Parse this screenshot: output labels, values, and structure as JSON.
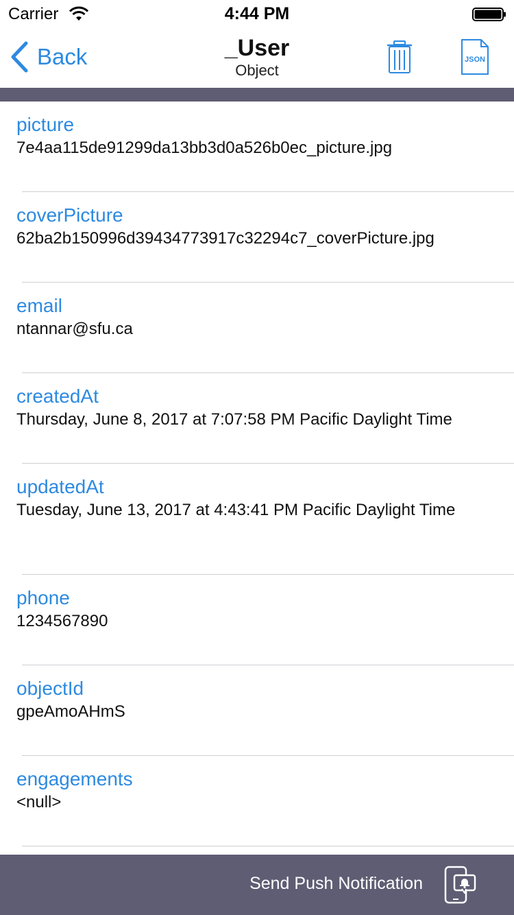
{
  "status": {
    "carrier": "Carrier",
    "time": "4:44 PM"
  },
  "nav": {
    "back_label": "Back",
    "title": "_User",
    "subtitle": "Object",
    "json_icon_text": "JSON"
  },
  "fields": [
    {
      "key": "picture",
      "value": "7e4aa115de91299da13bb3d0a526b0ec_picture.jpg"
    },
    {
      "key": "coverPicture",
      "value": "62ba2b150996d39434773917c32294c7_coverPicture.jpg"
    },
    {
      "key": "email",
      "value": "ntannar@sfu.ca"
    },
    {
      "key": "createdAt",
      "value": "Thursday, June 8, 2017 at 7:07:58 PM Pacific Daylight Time"
    },
    {
      "key": "updatedAt",
      "value": "Tuesday, June 13, 2017 at 4:43:41 PM Pacific Daylight Time"
    },
    {
      "key": "phone",
      "value": "1234567890"
    },
    {
      "key": "objectId",
      "value": "gpeAmoAHmS"
    },
    {
      "key": "engagements",
      "value": "<null>"
    }
  ],
  "bottom": {
    "push_label": "Send Push Notification"
  },
  "colors": {
    "accent": "#2d8ae0",
    "bar": "#5f5d73",
    "separator": "#cfcfd4"
  },
  "icons": [
    "wifi-icon",
    "battery-icon",
    "back-chevron-icon",
    "trash-icon",
    "json-file-icon",
    "push-notification-icon"
  ]
}
